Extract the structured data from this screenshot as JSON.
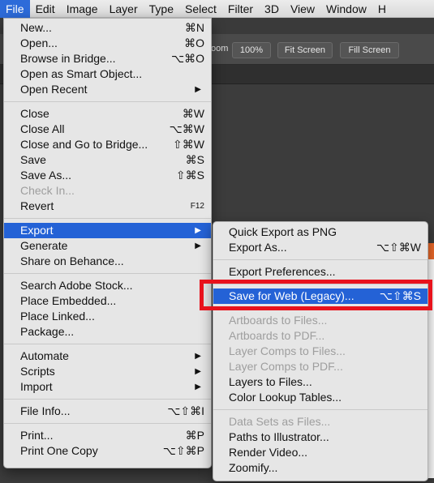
{
  "menubar": [
    "File",
    "Edit",
    "Image",
    "Layer",
    "Type",
    "Select",
    "Filter",
    "3D",
    "View",
    "Window",
    "H"
  ],
  "optionsbar": {
    "zoom_label": "oom",
    "buttons": [
      "100%",
      "Fit Screen",
      "Fill Screen"
    ]
  },
  "file_menu": {
    "groups": [
      [
        {
          "label": "New...",
          "shortcut": "⌘N"
        },
        {
          "label": "Open...",
          "shortcut": "⌘O"
        },
        {
          "label": "Browse in Bridge...",
          "shortcut": "⌥⌘O"
        },
        {
          "label": "Open as Smart Object...",
          "shortcut": ""
        },
        {
          "label": "Open Recent",
          "shortcut": "",
          "submenu": true
        }
      ],
      [
        {
          "label": "Close",
          "shortcut": "⌘W"
        },
        {
          "label": "Close All",
          "shortcut": "⌥⌘W"
        },
        {
          "label": "Close and Go to Bridge...",
          "shortcut": "⇧⌘W"
        },
        {
          "label": "Save",
          "shortcut": "⌘S"
        },
        {
          "label": "Save As...",
          "shortcut": "⇧⌘S"
        },
        {
          "label": "Check In...",
          "shortcut": "",
          "disabled": true
        },
        {
          "label": "Revert",
          "shortcut": "F12",
          "small": true
        }
      ],
      [
        {
          "label": "Export",
          "shortcut": "",
          "submenu": true,
          "highlighted": true
        },
        {
          "label": "Generate",
          "shortcut": "",
          "submenu": true
        },
        {
          "label": "Share on Behance...",
          "shortcut": ""
        }
      ],
      [
        {
          "label": "Search Adobe Stock...",
          "shortcut": ""
        },
        {
          "label": "Place Embedded...",
          "shortcut": ""
        },
        {
          "label": "Place Linked...",
          "shortcut": ""
        },
        {
          "label": "Package...",
          "shortcut": ""
        }
      ],
      [
        {
          "label": "Automate",
          "shortcut": "",
          "submenu": true
        },
        {
          "label": "Scripts",
          "shortcut": "",
          "submenu": true
        },
        {
          "label": "Import",
          "shortcut": "",
          "submenu": true
        }
      ],
      [
        {
          "label": "File Info...",
          "shortcut": "⌥⇧⌘I"
        }
      ],
      [
        {
          "label": "Print...",
          "shortcut": "⌘P"
        },
        {
          "label": "Print One Copy",
          "shortcut": "⌥⇧⌘P"
        }
      ]
    ]
  },
  "export_menu": {
    "groups": [
      [
        {
          "label": "Quick Export as PNG",
          "shortcut": ""
        },
        {
          "label": "Export As...",
          "shortcut": "⌥⇧⌘W"
        }
      ],
      [
        {
          "label": "Export Preferences...",
          "shortcut": ""
        }
      ],
      [
        {
          "label": "Save for Web (Legacy)...",
          "shortcut": "⌥⇧⌘S",
          "highlighted": true
        }
      ],
      [
        {
          "label": "Artboards to Files...",
          "shortcut": "",
          "disabled": true
        },
        {
          "label": "Artboards to PDF...",
          "shortcut": "",
          "disabled": true
        },
        {
          "label": "Layer Comps to Files...",
          "shortcut": "",
          "disabled": true
        },
        {
          "label": "Layer Comps to PDF...",
          "shortcut": "",
          "disabled": true
        },
        {
          "label": "Layers to Files...",
          "shortcut": ""
        },
        {
          "label": "Color Lookup Tables...",
          "shortcut": ""
        }
      ],
      [
        {
          "label": "Data Sets as Files...",
          "shortcut": "",
          "disabled": true
        },
        {
          "label": "Paths to Illustrator...",
          "shortcut": ""
        },
        {
          "label": "Render Video...",
          "shortcut": ""
        },
        {
          "label": "Zoomify...",
          "shortcut": ""
        }
      ]
    ]
  },
  "colors": {
    "highlight": "#2462d6",
    "callout_border": "#e8121c",
    "menu_bg": "#e6e6e6"
  }
}
